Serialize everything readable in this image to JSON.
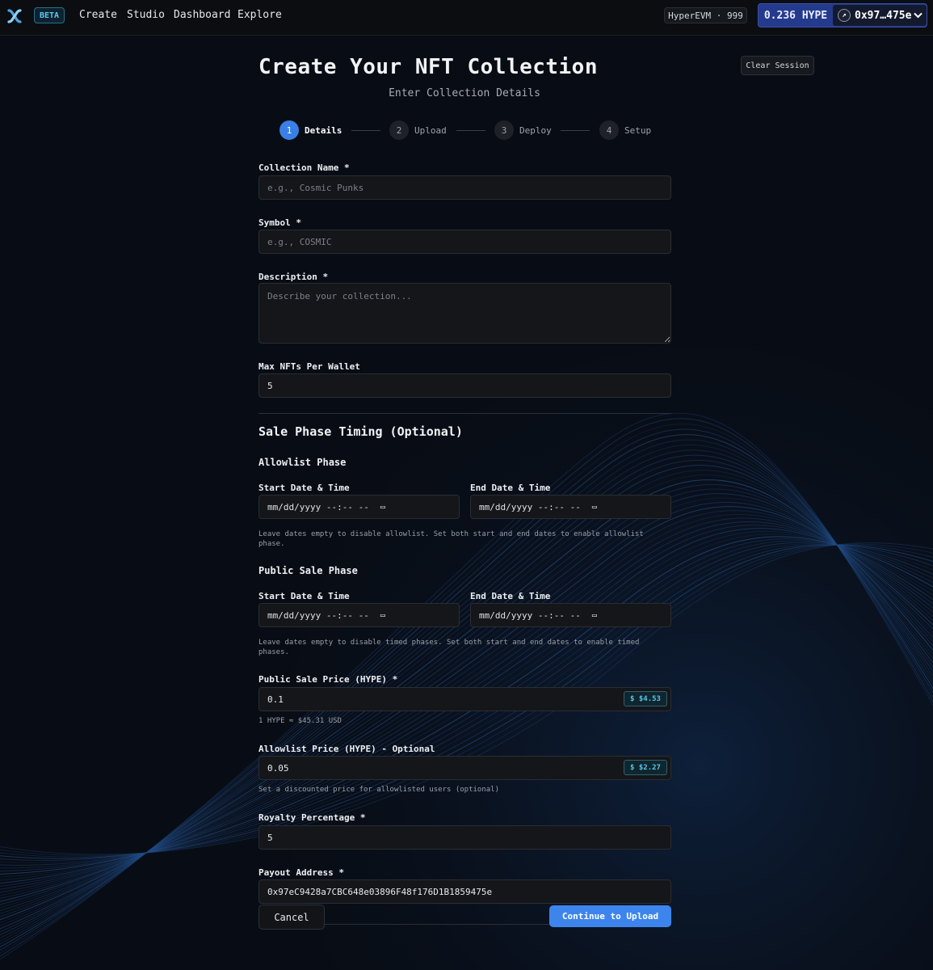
{
  "nav": {
    "beta_badge": "BETA",
    "links": [
      "Create",
      "Studio",
      "Dashboard",
      "Explore"
    ],
    "chain_label": "HyperEVM · 999",
    "balance": "0.236 HYPE",
    "wallet_address": "0x97…475e"
  },
  "header": {
    "title": "Create Your NFT Collection",
    "subtitle": "Enter Collection Details",
    "clear_session": "Clear Session"
  },
  "steps": [
    {
      "num": "1",
      "label": "Details",
      "active": true
    },
    {
      "num": "2",
      "label": "Upload",
      "active": false
    },
    {
      "num": "3",
      "label": "Deploy",
      "active": false
    },
    {
      "num": "4",
      "label": "Setup",
      "active": false
    }
  ],
  "form": {
    "collection_name": {
      "label": "Collection Name *",
      "placeholder": "e.g., Cosmic Punks",
      "value": ""
    },
    "symbol": {
      "label": "Symbol *",
      "placeholder": "e.g., COSMIC",
      "value": ""
    },
    "description": {
      "label": "Description *",
      "placeholder": "Describe your collection...",
      "value": ""
    },
    "max_per_wallet": {
      "label": "Max NFTs Per Wallet",
      "value": "5"
    },
    "sale_timing_title": "Sale Phase Timing (Optional)",
    "allowlist_phase": {
      "title": "Allowlist Phase",
      "start_label": "Start Date & Time",
      "end_label": "End Date & Time",
      "start_placeholder": "mm/dd/yyyy --:-- --",
      "end_placeholder": "mm/dd/yyyy --:-- --",
      "help": "Leave dates empty to disable allowlist. Set both start and end dates to enable allowlist phase."
    },
    "public_phase": {
      "title": "Public Sale Phase",
      "start_label": "Start Date & Time",
      "end_label": "End Date & Time",
      "start_placeholder": "mm/dd/yyyy --:-- --",
      "end_placeholder": "mm/dd/yyyy --:-- --",
      "help": "Leave dates empty to disable timed phases. Set both start and end dates to enable timed phases."
    },
    "public_price": {
      "label": "Public Sale Price (HYPE) *",
      "value": "0.1",
      "usd": "$ $4.53",
      "help": "1 HYPE ≈ $45.31 USD"
    },
    "allowlist_price": {
      "label": "Allowlist Price (HYPE) - Optional",
      "value": "0.05",
      "usd": "$ $2.27",
      "help": "Set a discounted price for allowlisted users (optional)"
    },
    "royalty": {
      "label": "Royalty Percentage *",
      "value": "5"
    },
    "payout_address": {
      "label": "Payout Address *",
      "value": "0x97eC9428a7CBC648e03896F48f176D1B1859475e"
    }
  },
  "actions": {
    "cancel": "Cancel",
    "continue": "Continue to Upload"
  },
  "colors": {
    "accent": "#3d85ec",
    "wallet": "#243a8c",
    "badge": "#56c4e6"
  }
}
